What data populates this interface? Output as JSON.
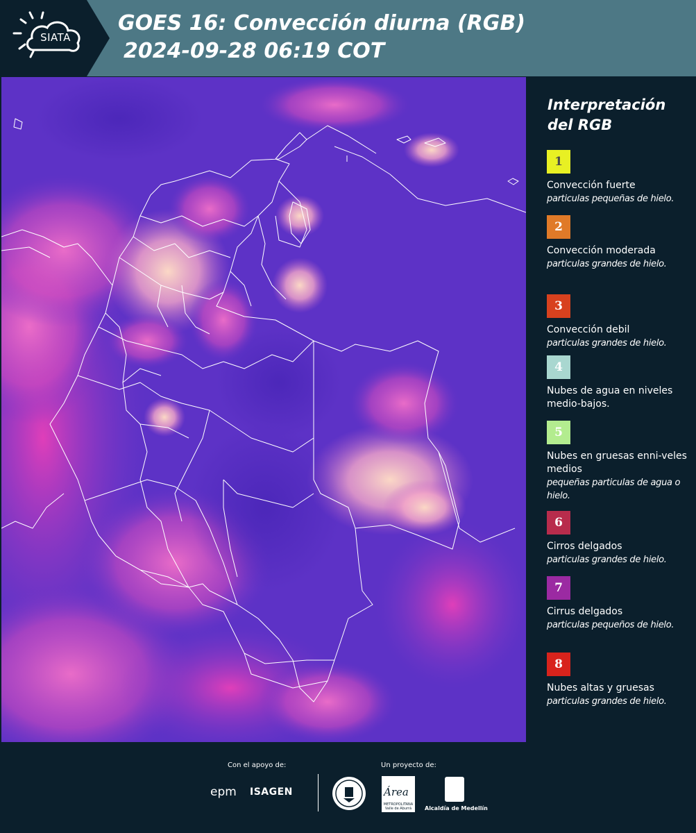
{
  "header": {
    "logo": "SIATA",
    "title_line1": "GOES 16: Convección diurna (RGB)",
    "title_line2": "2024-09-28 06:19 COT",
    "background": "#4d7885"
  },
  "map": {
    "description_icon": "satellite-rgb-composite",
    "palette": {
      "base": "#5a2fc4",
      "pink": "#f06fc8",
      "magenta": "#e040b0",
      "cream": "#f5c6b8"
    }
  },
  "legend": {
    "title_line1": "Interpretación",
    "title_line2": "del RGB",
    "items": [
      {
        "num": "1",
        "color": "#e8f023",
        "text_color": "#4a4a4a",
        "label": "Convección fuerte",
        "sub": "particulas pequeñas de hielo."
      },
      {
        "num": "2",
        "color": "#e07a28",
        "text_color": "#ffffff",
        "label": "Convección moderada",
        "sub": "particulas grandes de hielo."
      },
      {
        "num": "3",
        "color": "#d8411e",
        "text_color": "#ffffff",
        "label": "Convección debil",
        "sub": "particulas grandes de hielo."
      },
      {
        "num": "4",
        "color": "#a9d7d0",
        "text_color": "#ffffff",
        "label": "Nubes de agua en niveles medio-bajos.",
        "sub": ""
      },
      {
        "num": "5",
        "color": "#b3ec8f",
        "text_color": "#ffffff",
        "label": "Nubes en gruesas enni-veles medios",
        "sub": "pequeñas particulas de agua o hielo."
      },
      {
        "num": "6",
        "color": "#b82c4c",
        "text_color": "#ffffff",
        "label": "Cirros delgados",
        "sub": "particulas grandes de hielo."
      },
      {
        "num": "7",
        "color": "#9b2aa2",
        "text_color": "#ffffff",
        "label": "Cirrus delgados",
        "sub": "particulas pequeños de hielo."
      },
      {
        "num": "8",
        "color": "#d8231c",
        "text_color": "#ffffff",
        "label": "Nubes altas y gruesas",
        "sub": "particulas grandes de hielo."
      }
    ]
  },
  "footer": {
    "support_label": "Con el apoyo de:",
    "project_label": "Un proyecto de:",
    "epm": "epm",
    "isagen": "ISAGEN",
    "area": "Área",
    "area_sub": "METROPOLITANA Valle de Aburrá",
    "medellin": "Alcaldía de Medellín"
  }
}
